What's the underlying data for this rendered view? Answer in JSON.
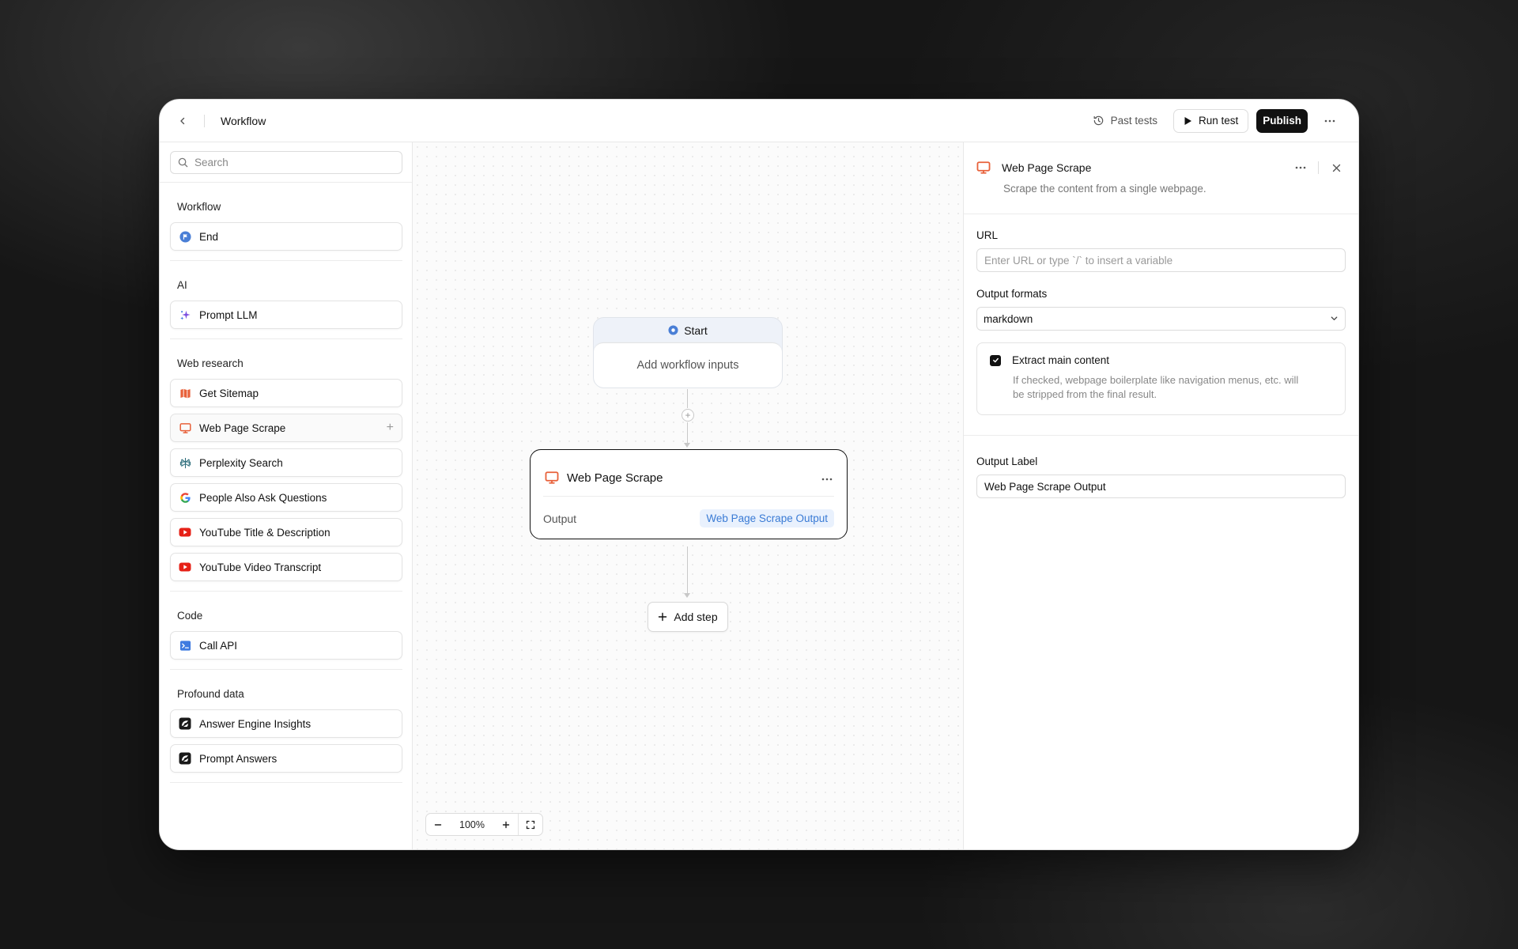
{
  "topbar": {
    "title": "Workflow",
    "past_tests": "Past tests",
    "run_test": "Run test",
    "publish": "Publish"
  },
  "sidebar": {
    "search_placeholder": "Search",
    "sections": [
      {
        "title": "Workflow",
        "items": [
          {
            "label": "End",
            "icon": "flag-icon"
          }
        ]
      },
      {
        "title": "AI",
        "items": [
          {
            "label": "Prompt LLM",
            "icon": "sparkle-icon"
          }
        ]
      },
      {
        "title": "Web research",
        "items": [
          {
            "label": "Get Sitemap",
            "icon": "map-icon"
          },
          {
            "label": "Web Page Scrape",
            "icon": "monitor-icon"
          },
          {
            "label": "Perplexity Search",
            "icon": "perplexity-icon"
          },
          {
            "label": "People Also Ask Questions",
            "icon": "google-icon"
          },
          {
            "label": "YouTube Title & Description",
            "icon": "youtube-icon"
          },
          {
            "label": "YouTube Video Transcript",
            "icon": "youtube-icon"
          }
        ]
      },
      {
        "title": "Code",
        "items": [
          {
            "label": "Call API",
            "icon": "terminal-icon"
          }
        ]
      },
      {
        "title": "Profound data",
        "items": [
          {
            "label": "Answer Engine Insights",
            "icon": "profound-icon"
          },
          {
            "label": "Prompt Answers",
            "icon": "profound-icon"
          }
        ]
      }
    ]
  },
  "canvas": {
    "start_label": "Start",
    "start_body": "Add workflow inputs",
    "step_title": "Web Page Scrape",
    "step_output_label": "Output",
    "step_output_chip": "Web Page Scrape Output",
    "add_step": "Add step",
    "zoom": "100%"
  },
  "panel": {
    "title": "Web Page Scrape",
    "description": "Scrape the content from a single webpage.",
    "url_label": "URL",
    "url_placeholder": "Enter URL or type `/` to insert a variable",
    "formats_label": "Output formats",
    "formats_value": "markdown",
    "extract_label": "Extract main content",
    "extract_desc_1": "If checked, webpage boilerplate like navigation menus, etc. will",
    "extract_desc_2": "be stripped from the final result.",
    "extract_checked": true,
    "output_label_title": "Output Label",
    "output_label_value": "Web Page Scrape Output"
  },
  "colors": {
    "accent_orange": "#e8613a",
    "accent_blue": "#3a7bd5",
    "youtube_red": "#e62117"
  }
}
